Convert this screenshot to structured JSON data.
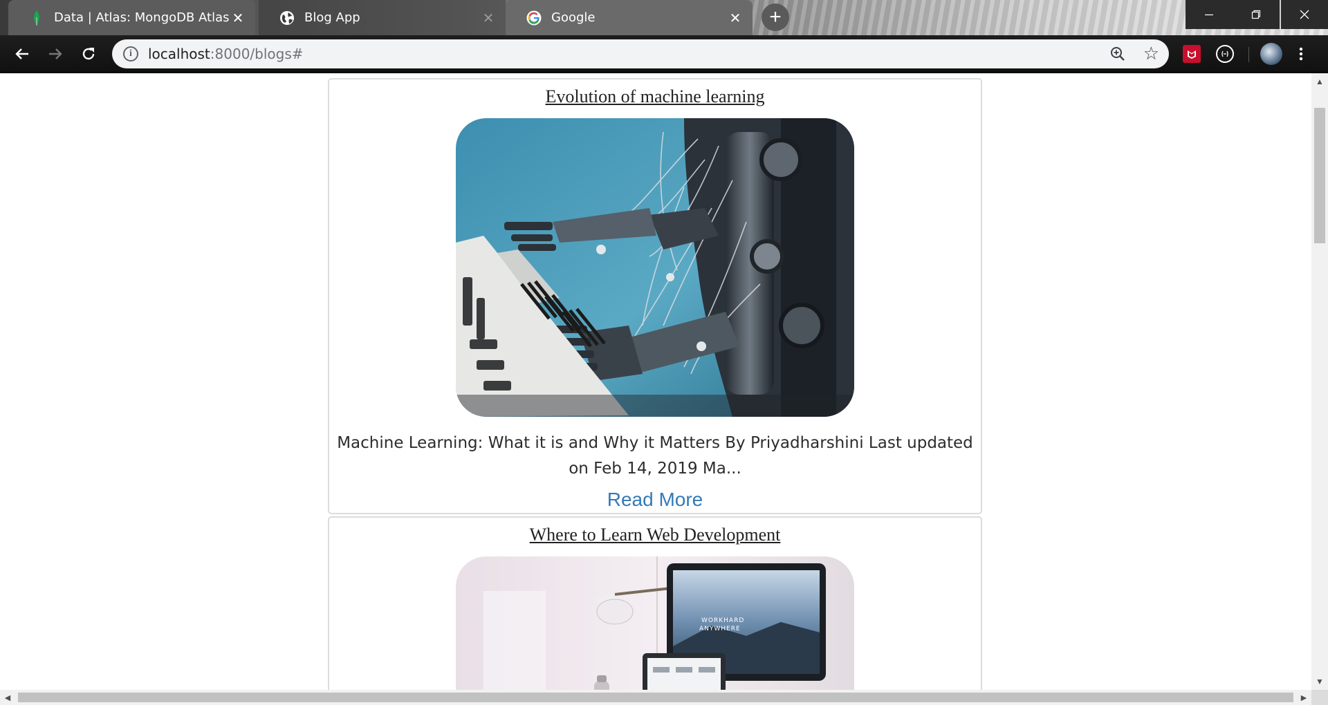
{
  "browser": {
    "tabs": [
      {
        "title": "Data | Atlas: MongoDB Atlas",
        "favicon": "mongodb-leaf-icon"
      },
      {
        "title": "Blog App",
        "favicon": "globe-icon"
      },
      {
        "title": "Google",
        "favicon": "google-g-icon"
      }
    ],
    "new_tab_label": "+",
    "address": {
      "host": "localhost",
      "rest": ":8000/blogs#"
    }
  },
  "posts": [
    {
      "title": "Evolution of machine learning",
      "image": "robot-hands-playing-piano-image",
      "excerpt": "Machine Learning: What it is and Why it Matters By Priyadharshini Last updated on Feb 14, 2019 Ma...",
      "read_more": "Read More"
    },
    {
      "title": "Where to Learn Web Development",
      "image": "desk-with-monitor-and-lamp-image",
      "monitor_caption_line1": "WORKHARD",
      "monitor_caption_line2": "ANYWHERE"
    }
  ],
  "colors": {
    "link": "#337ab7",
    "card_border": "#dcdcdc",
    "mongodb_green": "#13aa52"
  }
}
